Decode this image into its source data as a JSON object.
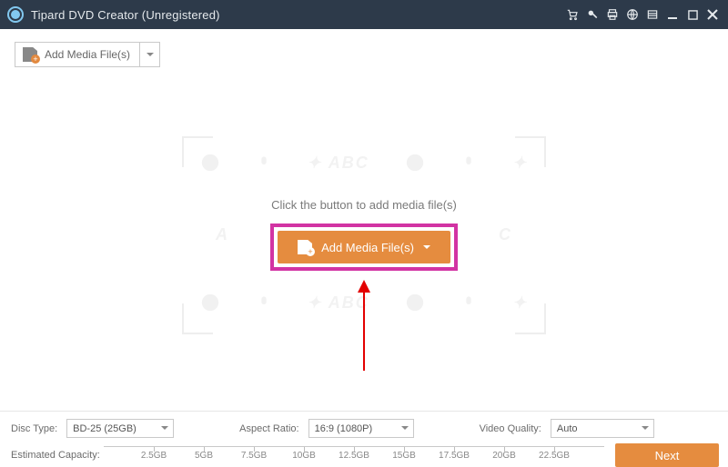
{
  "titlebar": {
    "title": "Tipard DVD Creator (Unregistered)"
  },
  "toolbar": {
    "add_media_label": "Add Media File(s)"
  },
  "dropzone": {
    "instruction": "Click the button to add media file(s)",
    "add_media_label": "Add Media File(s)"
  },
  "footer": {
    "disc_type_label": "Disc Type:",
    "disc_type_value": "BD-25 (25GB)",
    "aspect_ratio_label": "Aspect Ratio:",
    "aspect_ratio_value": "16:9 (1080P)",
    "video_quality_label": "Video Quality:",
    "video_quality_value": "Auto",
    "estimated_capacity_label": "Estimated Capacity:",
    "capacity_ticks": [
      "2.5GB",
      "5GB",
      "7.5GB",
      "10GB",
      "12.5GB",
      "15GB",
      "17.5GB",
      "20GB",
      "22.5GB"
    ],
    "next_label": "Next"
  },
  "colors": {
    "accent": "#e58c3f",
    "highlight": "#d233a3",
    "titlebar": "#2d3a4a"
  }
}
